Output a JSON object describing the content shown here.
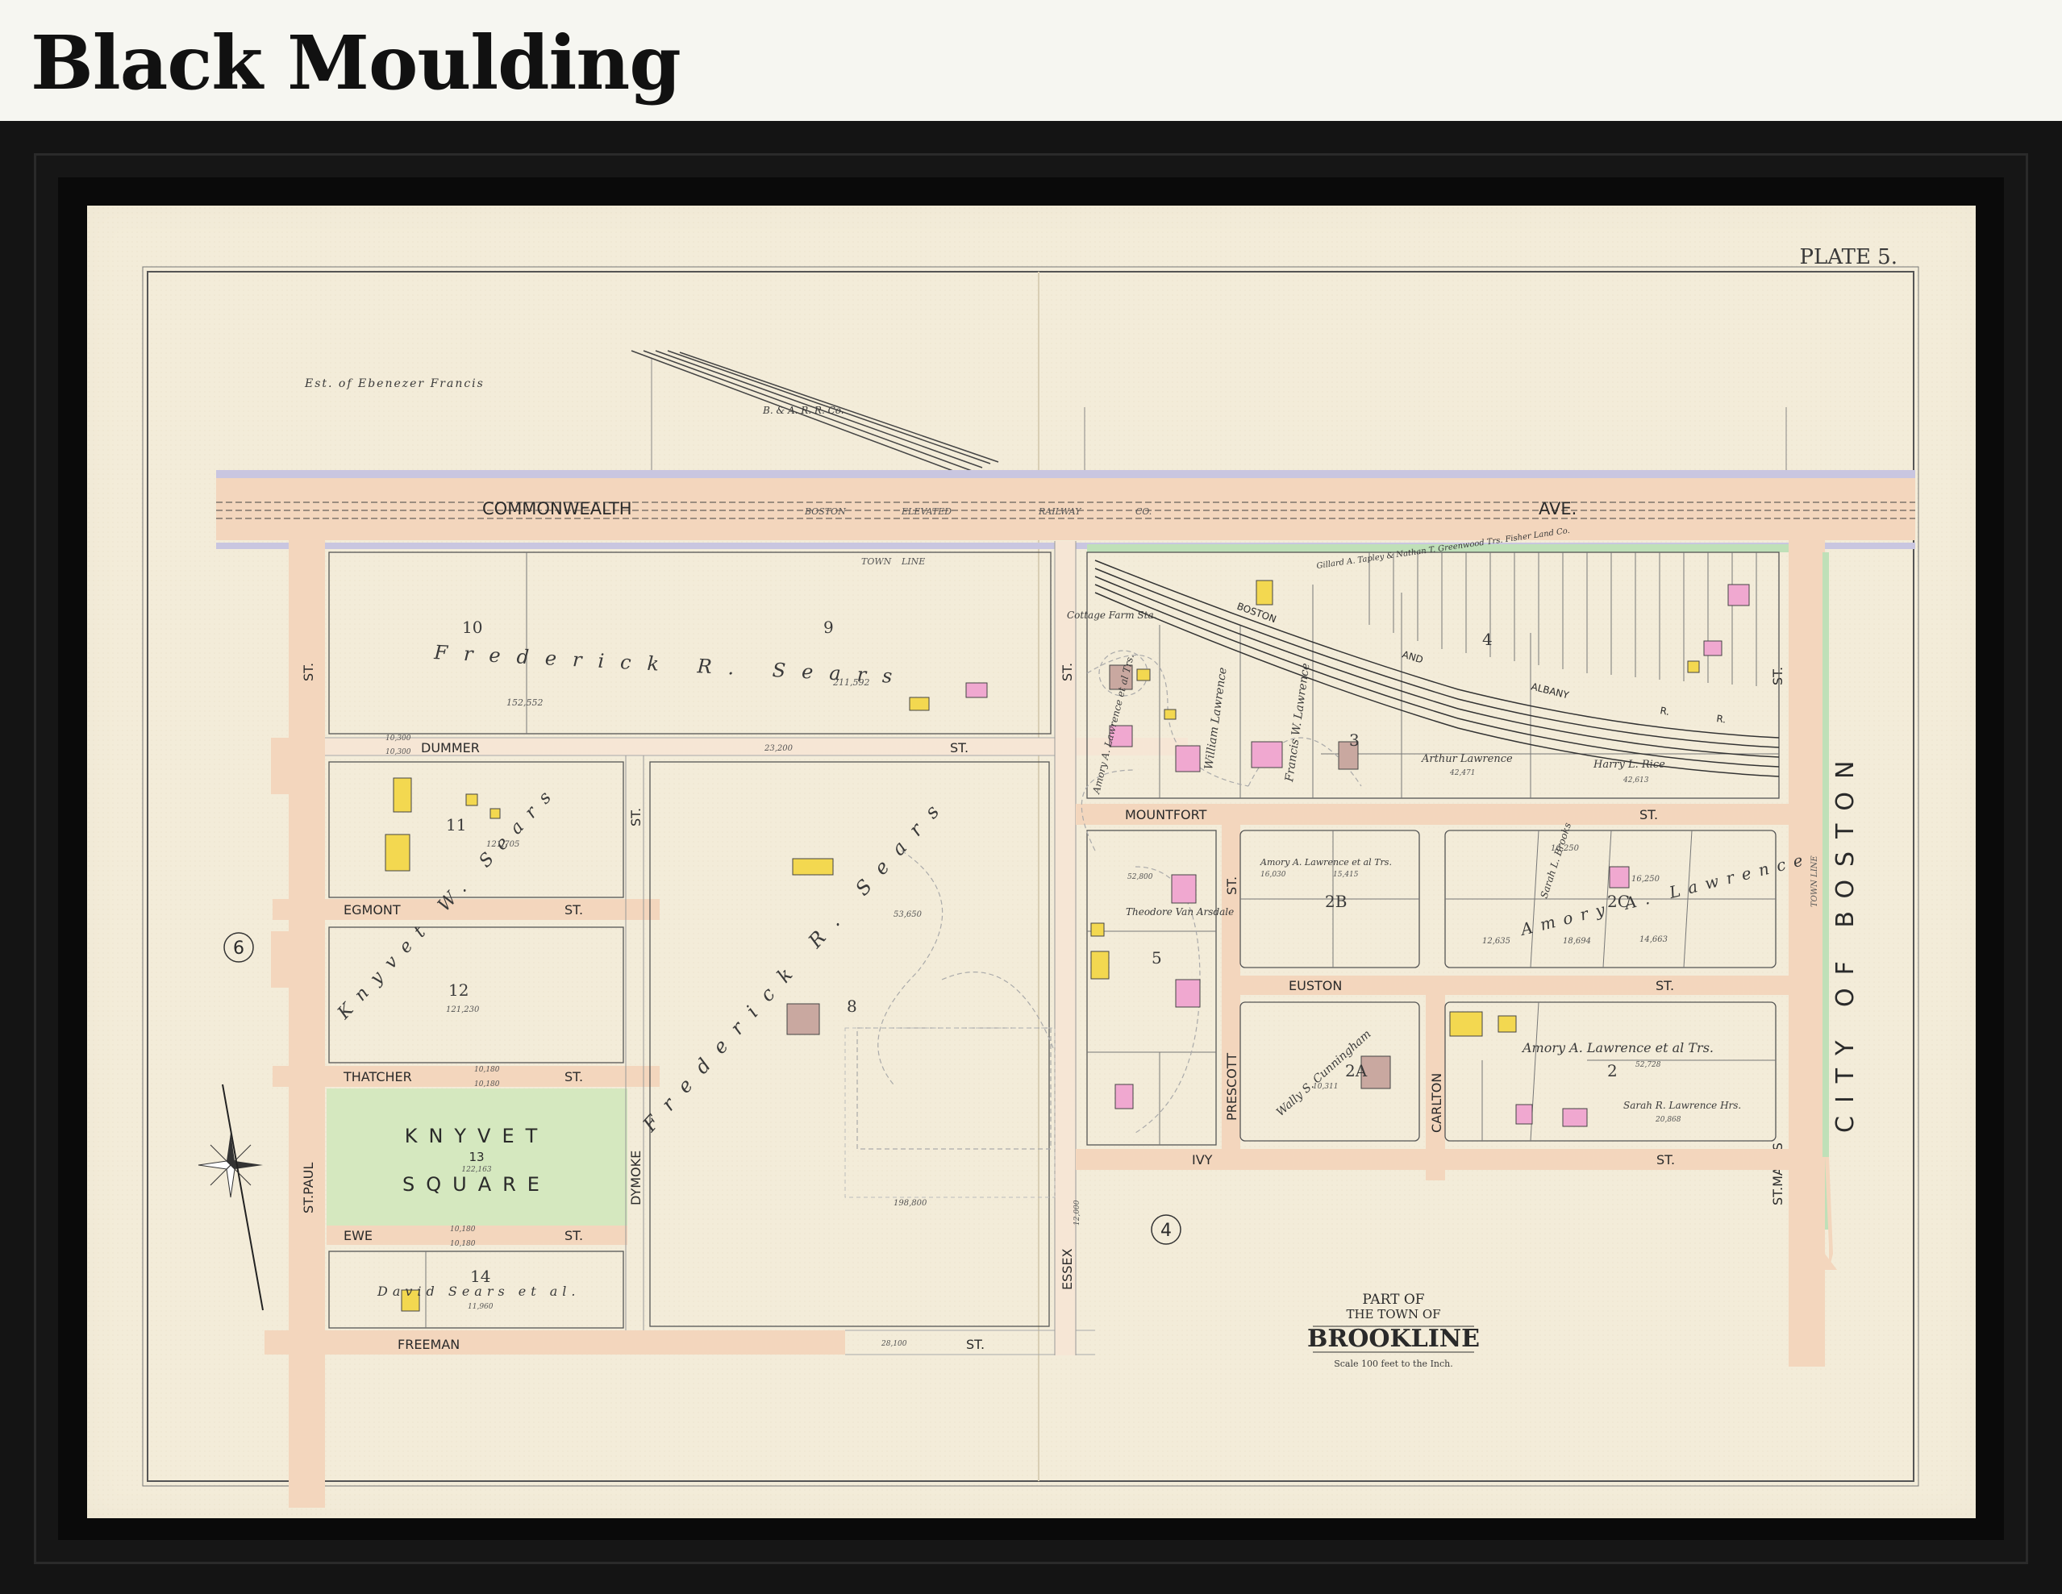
{
  "header": {
    "title": "Black Moulding"
  },
  "map": {
    "plate": "PLATE 5.",
    "cartouche": {
      "line1": "PART OF",
      "line2": "THE TOWN OF",
      "line3": "BROOKLINE",
      "scale": "Scale 100 feet to the Inch."
    },
    "streets": {
      "commonwealth": "COMMONWEALTH",
      "ave": "AVE.",
      "boston": "BOSTON",
      "elevated": "ELEVATED",
      "railway": "RAILWAY",
      "co": "CO.",
      "town_line": "TOWN",
      "line": "LINE",
      "dummer": "DUMMER",
      "dummer_st": "ST.",
      "egmont": "EGMONT",
      "egmont_st": "ST.",
      "thatcher": "THATCHER",
      "thatcher_st": "ST.",
      "ewe": "EWE",
      "ewe_st": "ST.",
      "freeman": "FREEMAN",
      "freeman_st": "ST.",
      "st_paul": "ST.PAUL",
      "st_paul_top": "ST.",
      "dymoke": "DYMOKE",
      "dymoke_st": "ST.",
      "essex": "ESSEX",
      "essex_st": "ST.",
      "mountfort": "MOUNTFORT",
      "mountfort_st": "ST.",
      "euston": "EUSTON",
      "euston_st": "ST.",
      "ivy": "IVY",
      "ivy_st": "ST.",
      "prescott": "PRESCOTT",
      "prescott_st": "ST.",
      "carlton": "CARLTON",
      "carlton_st": "ST.",
      "st_marys": "ST.MARYS",
      "st_marys_st": "ST.",
      "city_of_boston": "CITY OF BOSTON",
      "boston_rr": "BOSTON",
      "and": "AND",
      "albany": "ALBANY",
      "r1": "R.",
      "r2": "R.",
      "town_line_right": "TOWN LINE"
    },
    "owners": {
      "ebenezer": "Est. of Ebenezer Francis",
      "bara": "B. & A. R. R. Co.",
      "frederick_top": "Frederick R. Sears",
      "knyvet": "Knyvet W. Sears",
      "frederick_mid": "Frederick R. Sears",
      "david": "David Sears et al.",
      "amory": "Amory A. Lawrence et al Trs.",
      "arthur": "Arthur Lawrence",
      "harry": "Harry L. Rice",
      "sarah_brooks": "Sarah L. Brooks",
      "amory2c": "Amory A. Lawrence",
      "theodore": "Theodore Van Arsdale",
      "wally": "Wally S. Cunningham",
      "amory2": "Amory A. Lawrence et al Trs.",
      "sarah_lawrence": "Sarah R. Lawrence Hrs.",
      "cottage": "Cottage Farm Sta.",
      "william": "William Lawrence",
      "francis": "Francis W. Lawrence",
      "gilbert": "Gillard A. Tapley & Nathan T. Greenwood Trs. Fisher Land Co."
    },
    "parcels": {
      "p10": "10",
      "p9": "9",
      "p11": "11",
      "p12": "12",
      "p13": "13",
      "p14": "14",
      "p8": "8",
      "p3": "3",
      "p4": "4",
      "p5": "5",
      "p2a": "2A",
      "p2b": "2B",
      "p2c": "2C",
      "p2": "2",
      "knyvet1": "KNYVET",
      "knyvet2": "SQUARE",
      "circle6": "6",
      "circle4": "4"
    },
    "areas": {
      "a10": "152,552",
      "a9": "211,592",
      "a11": "121,705",
      "a12": "121,230",
      "a13": "122,163",
      "a14": "11,960",
      "a8": "53,650",
      "adummer": "23,200",
      "afreeman": "28,100",
      "aessex": "12,000",
      "a198": "198,800",
      "a3": "42,471",
      "arice": "42,613",
      "a2b1": "16,030",
      "a2b2": "15,415",
      "a2c1": "16,250",
      "a2c2": "16,250",
      "a2c3": "14,663",
      "a2c4": "18,694",
      "a2c5": "12,635",
      "a5": "52,800",
      "a2a": "10,311",
      "a2": "52,728",
      "a2_2": "20,868",
      "athat1": "10,180",
      "athat2": "10,180",
      "aewe1": "10,180",
      "aewe2": "10,180",
      "adum1": "10,300",
      "adum2": "10,300"
    }
  }
}
